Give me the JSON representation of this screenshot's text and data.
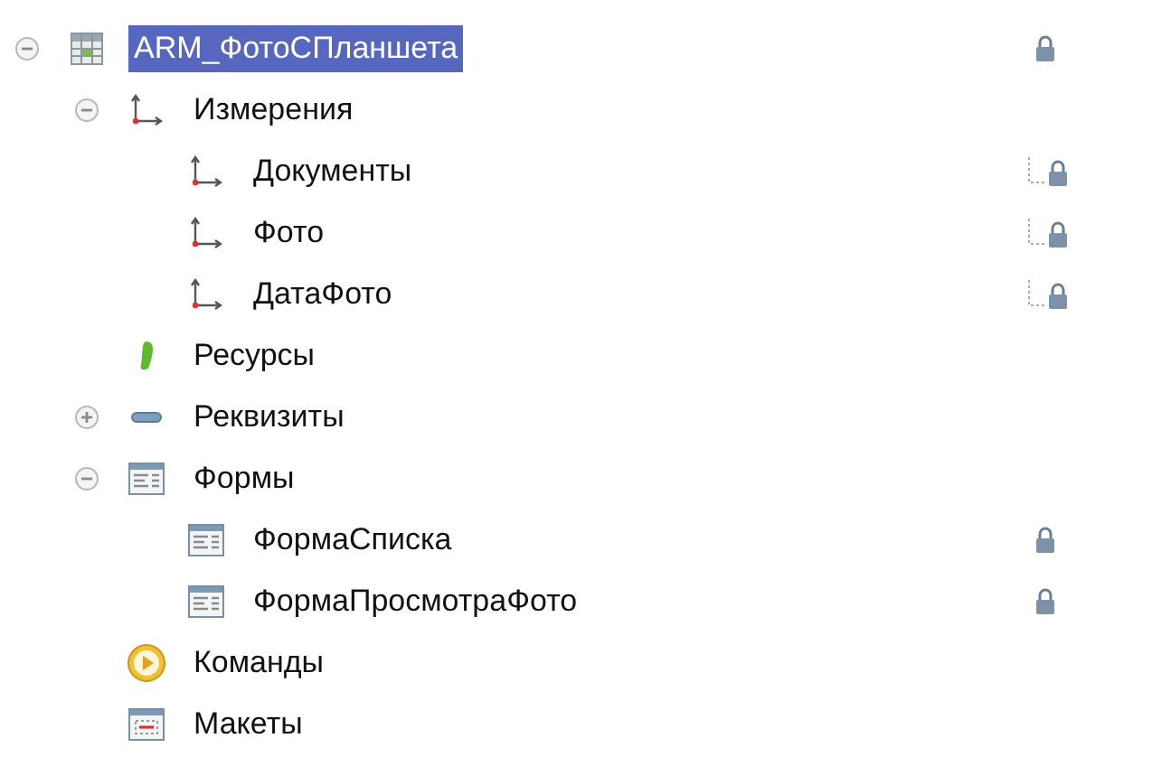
{
  "tree": [
    {
      "label": "ARM_ФотоСПланшета",
      "kind": "table",
      "expanded": true,
      "selected": true,
      "locked": true,
      "children": [
        {
          "label": "Измерения",
          "kind": "dimension",
          "expanded": true,
          "selected": false,
          "locked": false,
          "children": [
            {
              "label": "Документы",
              "kind": "dimension",
              "selected": false,
              "locked": true
            },
            {
              "label": "Фото",
              "kind": "dimension",
              "selected": false,
              "locked": true
            },
            {
              "label": "ДатаФото",
              "kind": "dimension",
              "selected": false,
              "locked": true
            }
          ]
        },
        {
          "label": "Ресурсы",
          "kind": "resource",
          "selected": false,
          "locked": false
        },
        {
          "label": "Реквизиты",
          "kind": "attribute",
          "expanded": false,
          "selected": false,
          "locked": false
        },
        {
          "label": "Формы",
          "kind": "form",
          "expanded": true,
          "selected": false,
          "locked": false,
          "children": [
            {
              "label": "ФормаСписка",
              "kind": "form",
              "selected": false,
              "locked": true
            },
            {
              "label": "ФормаПросмотраФото",
              "kind": "form",
              "selected": false,
              "locked": true
            }
          ]
        },
        {
          "label": "Команды",
          "kind": "command",
          "selected": false,
          "locked": false
        },
        {
          "label": "Макеты",
          "kind": "template",
          "selected": false,
          "locked": false
        }
      ]
    }
  ]
}
